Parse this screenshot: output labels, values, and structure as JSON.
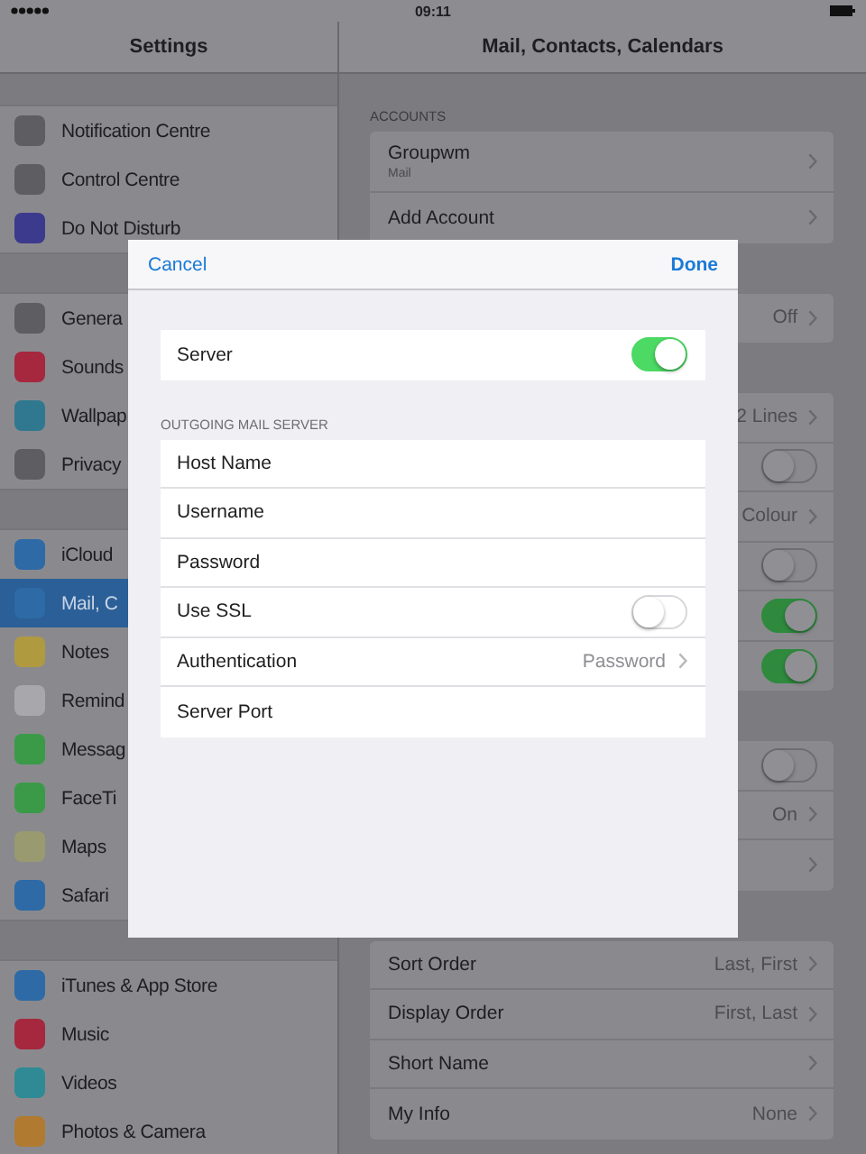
{
  "status_bar": {
    "time": "09:11"
  },
  "sidebar": {
    "title": "Settings",
    "groups": [
      [
        {
          "label": "Notification Centre",
          "color": "#5e5e62",
          "selected": false
        },
        {
          "label": "Control Centre",
          "color": "#5e5e62",
          "selected": false
        },
        {
          "label": "Do Not Disturb",
          "color": "#3c3a8c",
          "selected": false
        }
      ],
      [
        {
          "label": "Genera",
          "color": "#5e5e62",
          "selected": false
        },
        {
          "label": "Sounds",
          "color": "#a5283e",
          "selected": false
        },
        {
          "label": "Wallpap",
          "color": "#2f7890",
          "selected": false
        },
        {
          "label": "Privacy",
          "color": "#5e5e62",
          "selected": false
        }
      ],
      [
        {
          "label": "iCloud",
          "color": "#2d6aa6",
          "selected": false
        },
        {
          "label": "Mail, C",
          "color": "#2d6aa6",
          "selected": true
        },
        {
          "label": "Notes",
          "color": "#b09a40",
          "selected": false
        },
        {
          "label": "Remind",
          "color": "#a8a8ac",
          "selected": false
        },
        {
          "label": "Messag",
          "color": "#3a9a48",
          "selected": false
        },
        {
          "label": "FaceTi",
          "color": "#3a9a48",
          "selected": false
        },
        {
          "label": "Maps",
          "color": "#9a9a70",
          "selected": false
        },
        {
          "label": "Safari",
          "color": "#2d6aa6",
          "selected": false
        }
      ],
      [
        {
          "label": "iTunes & App Store",
          "color": "#2d6aa6",
          "selected": false
        },
        {
          "label": "Music",
          "color": "#a5283e",
          "selected": false
        },
        {
          "label": "Videos",
          "color": "#2f8a96",
          "selected": false
        },
        {
          "label": "Photos & Camera",
          "color": "#b07a30",
          "selected": false
        }
      ]
    ]
  },
  "detail": {
    "title": "Mail, Contacts, Calendars",
    "accounts_header": "ACCOUNTS",
    "groups": [
      [
        {
          "kind": "account",
          "label": "Groupwm",
          "sublabel": "Mail"
        },
        {
          "kind": "link",
          "label": "Add Account"
        }
      ],
      [
        {
          "kind": "link",
          "value": "Off"
        }
      ],
      [
        {
          "kind": "link",
          "value": "2 Lines"
        },
        {
          "kind": "toggle",
          "on": false
        },
        {
          "kind": "link",
          "value": "Colour"
        },
        {
          "kind": "toggle",
          "on": false
        },
        {
          "kind": "toggle",
          "on": true
        },
        {
          "kind": "toggle",
          "on": true
        }
      ],
      [
        {
          "kind": "toggle",
          "on": false
        },
        {
          "kind": "link",
          "value": "On"
        },
        {
          "kind": "link"
        }
      ],
      [
        {
          "kind": "link",
          "label": "Sort Order",
          "value": "Last, First"
        },
        {
          "kind": "link",
          "label": "Display Order",
          "value": "First, Last"
        },
        {
          "kind": "link",
          "label": "Short Name"
        },
        {
          "kind": "link",
          "label": "My Info",
          "value": "None"
        }
      ]
    ]
  },
  "dialog": {
    "cancel": "Cancel",
    "done": "Done",
    "server": {
      "kind": "toggle",
      "label": "Server",
      "on": true
    },
    "section_header": "OUTGOING MAIL SERVER",
    "rows": [
      {
        "kind": "field",
        "label": "Host Name"
      },
      {
        "kind": "field",
        "label": "Username"
      },
      {
        "kind": "field",
        "label": "Password"
      },
      {
        "kind": "toggle",
        "label": "Use SSL",
        "on": false
      },
      {
        "kind": "link",
        "label": "Authentication",
        "value": "Password"
      },
      {
        "kind": "field",
        "label": "Server Port"
      }
    ]
  }
}
